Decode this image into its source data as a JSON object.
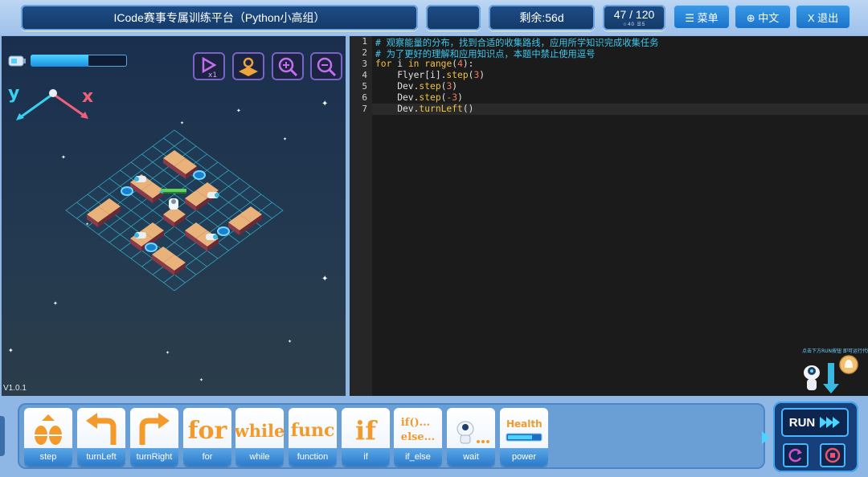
{
  "header": {
    "title": "ICode赛事专属训练平台（Python小高组）",
    "remaining": "剩余:56d",
    "progress": "47 / 120",
    "progress_sub": "☆40   ☰5",
    "menu_label": "☰ 菜单",
    "lang_label": "⊕ 中文",
    "exit_label": "X 退出"
  },
  "game": {
    "energy_level": 0.6,
    "axis_y_label": "y",
    "axis_x_label": "x",
    "version": "V1.0.1",
    "buttons": [
      "speed-button",
      "map-button",
      "zoom-in-button",
      "zoom-out-button"
    ],
    "speed_label": "x1"
  },
  "editor": {
    "line_numbers": [
      "1",
      "2",
      "3",
      "4",
      "5",
      "6",
      "7"
    ],
    "lines": [
      "# 观察能量的分布，找到合适的收集路线，应用所学知识完成收集任务",
      "# 为了更好的理解和应用知识点，本题中禁止使用逗号",
      "for i in range(4):",
      "    Flyer[i].step(3)",
      "    Dev.step(3)",
      "    Dev.step(-3)",
      "    Dev.turnLeft()"
    ],
    "help_text": "点击下方RUN按钮 即可运行代码"
  },
  "blocks": [
    {
      "label": "step",
      "icon": "step-icon"
    },
    {
      "label": "turnLeft",
      "icon": "turn-left-icon"
    },
    {
      "label": "turnRight",
      "icon": "turn-right-icon"
    },
    {
      "label": "for",
      "icon": "for-icon",
      "text": "for"
    },
    {
      "label": "while",
      "icon": "while-icon",
      "text": "while"
    },
    {
      "label": "function",
      "icon": "function-icon",
      "text": "func"
    },
    {
      "label": "if",
      "icon": "if-icon",
      "text": "if"
    },
    {
      "label": "if_else",
      "icon": "if-else-icon",
      "text": "if()...\nelse..."
    },
    {
      "label": "wait",
      "icon": "wait-icon"
    },
    {
      "label": "power",
      "icon": "power-icon",
      "text": "Health"
    }
  ],
  "run": {
    "label": "RUN"
  },
  "colors": {
    "accent": "#2d7ccc",
    "keyword": "#f0c23e",
    "comment": "#3ec7f0",
    "number": "#f07a5a",
    "block_text": "#f39a2b"
  }
}
